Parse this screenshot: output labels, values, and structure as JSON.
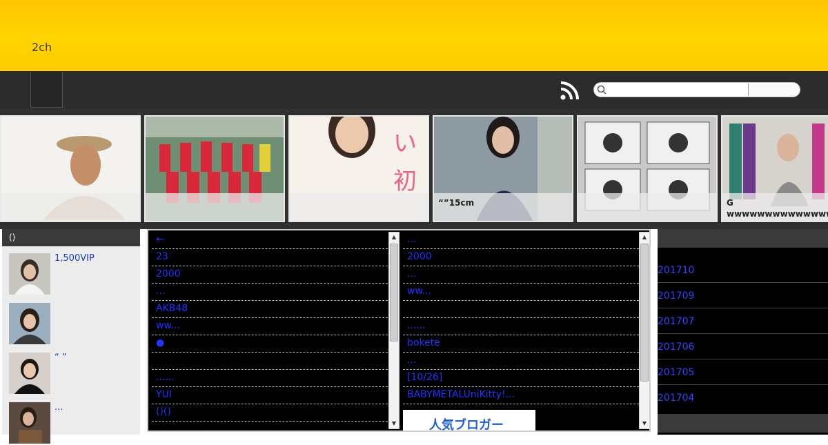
{
  "site": {
    "title": "2ch"
  },
  "search": {
    "placeholder": "",
    "button_label": ""
  },
  "strip": [
    {
      "caption": ""
    },
    {
      "caption": ""
    },
    {
      "caption": ""
    },
    {
      "caption": "“”15cm"
    },
    {
      "caption": ""
    },
    {
      "caption": "G wwwwwwwwwwwwwwwwww"
    }
  ],
  "left_sidebar": {
    "heading": "()",
    "items": [
      {
        "title": "1,500VIP"
      },
      {
        "title": ""
      },
      {
        "title": "“ ”"
      },
      {
        "title": "..."
      }
    ]
  },
  "antenna": {
    "left": [
      "←",
      "23",
      "2000",
      "...",
      "AKB48",
      "ww...",
      "●",
      "",
      "......",
      "YUI",
      "()()"
    ],
    "right": [
      "...",
      "2000",
      "...",
      "ww...",
      "",
      "......",
      "bokete",
      "...",
      "[10/26]",
      "BABYMETALUniKitty!..."
    ],
    "banner": "人気ブロガー"
  },
  "archives": {
    "heading": "",
    "items": [
      "201710",
      "201709",
      "201707",
      "201706",
      "201705",
      "201704"
    ]
  },
  "colors": {
    "header": "#ffcc00",
    "nav": "#2b2b2b",
    "link": "#2233ff"
  }
}
